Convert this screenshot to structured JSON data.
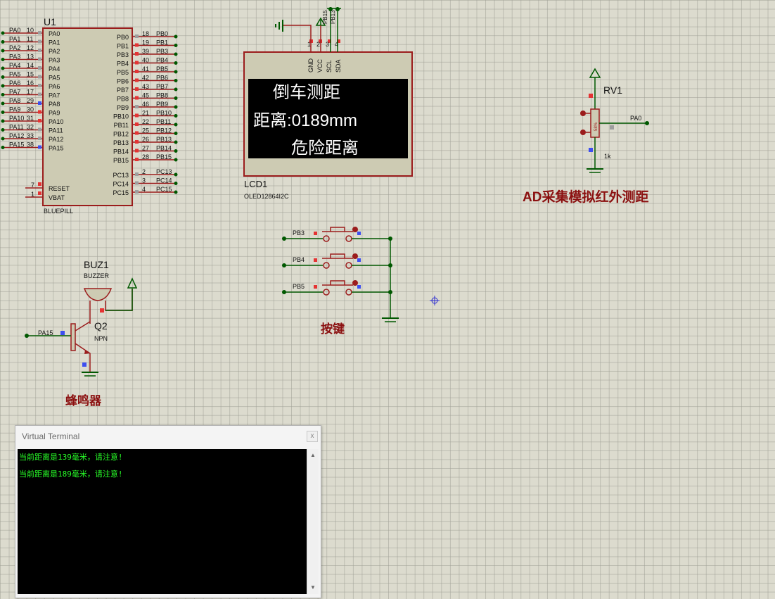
{
  "mcu": {
    "ref": "U1",
    "type": "BLUEPILL",
    "left_pins": [
      {
        "net": "PA0",
        "num": "10",
        "name": "PA0"
      },
      {
        "net": "PA1",
        "num": "11",
        "name": "PA1"
      },
      {
        "net": "PA2",
        "num": "12",
        "name": "PA2"
      },
      {
        "net": "PA3",
        "num": "13",
        "name": "PA3"
      },
      {
        "net": "PA4",
        "num": "14",
        "name": "PA4"
      },
      {
        "net": "PA5",
        "num": "15",
        "name": "PA5"
      },
      {
        "net": "PA6",
        "num": "16",
        "name": "PA6"
      },
      {
        "net": "PA7",
        "num": "17",
        "name": "PA7"
      },
      {
        "net": "PA8",
        "num": "29",
        "name": "PA8"
      },
      {
        "net": "PA9",
        "num": "30",
        "name": "PA9"
      },
      {
        "net": "PA10",
        "num": "31",
        "name": "PA10"
      },
      {
        "net": "PA11",
        "num": "32",
        "name": "PA11"
      },
      {
        "net": "PA12",
        "num": "33",
        "name": "PA12"
      },
      {
        "net": "PA15",
        "num": "38",
        "name": "PA15"
      }
    ],
    "right_pins": [
      {
        "net": "PB0",
        "num": "18",
        "name": "PB0"
      },
      {
        "net": "PB1",
        "num": "19",
        "name": "PB1"
      },
      {
        "net": "PB3",
        "num": "39",
        "name": "PB3"
      },
      {
        "net": "PB4",
        "num": "40",
        "name": "PB4"
      },
      {
        "net": "PB5",
        "num": "41",
        "name": "PB5"
      },
      {
        "net": "PB6",
        "num": "42",
        "name": "PB6"
      },
      {
        "net": "PB7",
        "num": "43",
        "name": "PB7"
      },
      {
        "net": "PB8",
        "num": "45",
        "name": "PB8"
      },
      {
        "net": "PB9",
        "num": "46",
        "name": "PB9"
      },
      {
        "net": "PB10",
        "num": "21",
        "name": "PB10"
      },
      {
        "net": "PB11",
        "num": "22",
        "name": "PB11"
      },
      {
        "net": "PB12",
        "num": "25",
        "name": "PB12"
      },
      {
        "net": "PB13",
        "num": "26",
        "name": "PB13"
      },
      {
        "net": "PB14",
        "num": "27",
        "name": "PB14"
      },
      {
        "net": "PB15",
        "num": "28",
        "name": "PB15"
      },
      {
        "net": "PC13",
        "num": "2",
        "name": "PC13"
      },
      {
        "net": "PC14",
        "num": "3",
        "name": "PC14"
      },
      {
        "net": "PC15",
        "num": "4",
        "name": "PC15"
      }
    ],
    "extra_left": [
      {
        "num": "7",
        "name": "RESET"
      },
      {
        "num": "1",
        "name": "VBAT"
      }
    ]
  },
  "lcd": {
    "ref": "LCD1",
    "type": "OLED12864I2C",
    "pins": [
      {
        "num": "1",
        "name": "GND"
      },
      {
        "num": "2",
        "name": "VCC"
      },
      {
        "num": "3",
        "name": "SCL"
      },
      {
        "num": "4",
        "name": "SDA"
      }
    ],
    "nets": [
      "PB15",
      "PB13"
    ],
    "lines": [
      "倒车测距",
      "距离:0189mm",
      "危险距离"
    ]
  },
  "pot": {
    "ref": "RV1",
    "value": "1k",
    "net": "PA0",
    "wiper": "58%"
  },
  "buzzer": {
    "ref": "BUZ1",
    "type": "BUZZER"
  },
  "transistor": {
    "ref": "Q2",
    "type": "NPN",
    "net": "PA15"
  },
  "buttons": {
    "nets": [
      "PB3",
      "PB4",
      "PB5"
    ]
  },
  "labels": {
    "ad": "AD采集模拟红外测距",
    "keys": "按键",
    "buzzer": "蜂鸣器"
  },
  "terminal": {
    "title": "Virtual Terminal",
    "close": "x",
    "lines": [
      "当前距离是139毫米，请注意!",
      "当前距离是189毫米，请注意!"
    ]
  },
  "colors": {
    "wire": "#005800",
    "component": "#9b1c1c",
    "body": "#cdcbb3",
    "label": "#8b1010",
    "terminal_text": "#28ff28"
  }
}
